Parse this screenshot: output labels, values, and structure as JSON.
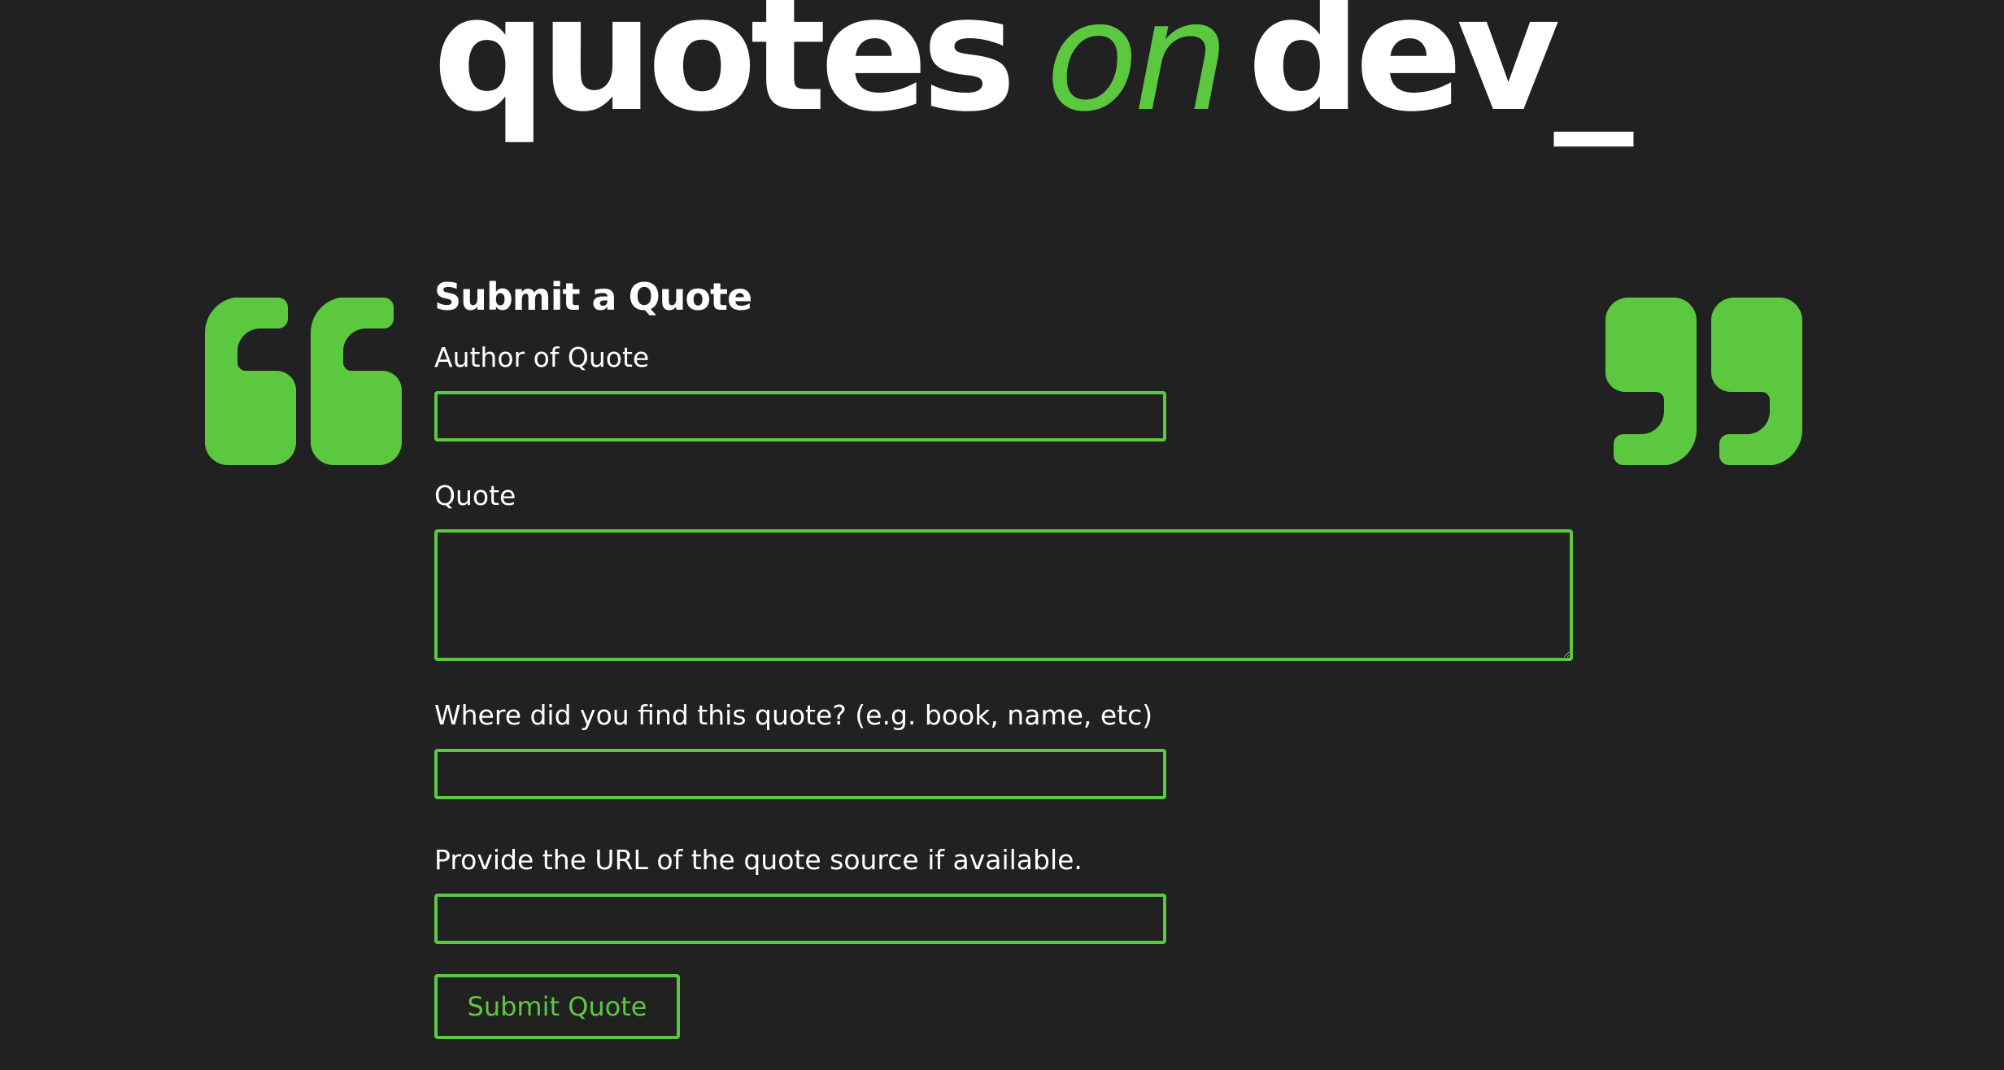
{
  "header": {
    "logo_word_1": "quotes",
    "logo_word_2": "on",
    "logo_word_3": "dev_"
  },
  "form": {
    "title": "Submit a Quote",
    "author_label": "Author of Quote",
    "author_value": "",
    "quote_label": "Quote",
    "quote_value": "",
    "source_label": "Where did you find this quote? (e.g. book, name, etc)",
    "source_value": "",
    "url_label": "Provide the URL of the quote source if available.",
    "url_value": "",
    "submit_label": "Submit Quote"
  },
  "icons": {
    "left": "open-quote-icon",
    "right": "close-quote-icon"
  },
  "colors": {
    "background": "#212121",
    "accent": "#5cc83f",
    "text": "#ffffff"
  }
}
